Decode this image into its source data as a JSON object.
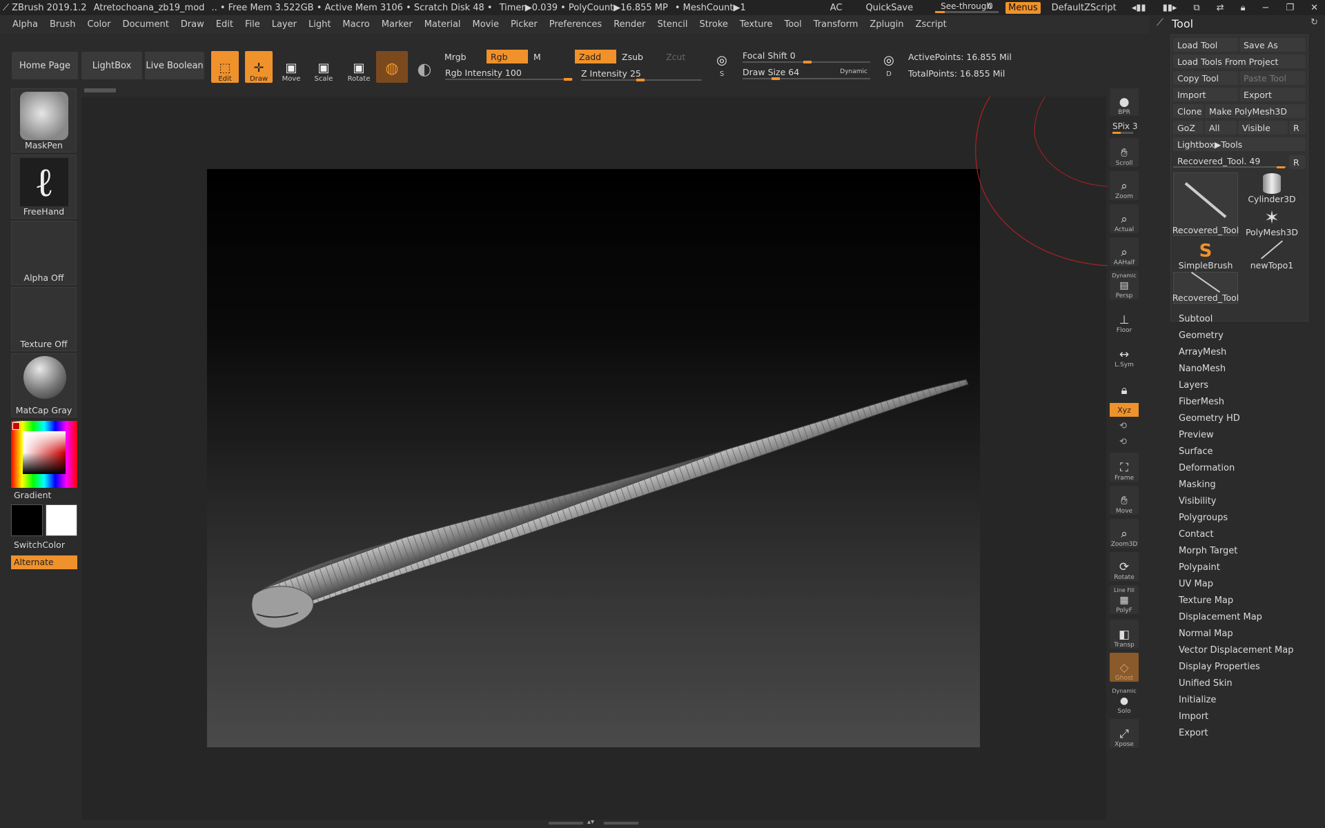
{
  "titlebar": {
    "app": "ZBrush 2019.1.2",
    "document": "Atretochoana_zb19_mod",
    "status": ".. • Free Mem 3.522GB • Active Mem 3106 • Scratch Disk 48 •",
    "timer": "Timer▶0.039 • PolyCount▶16.855 MP",
    "meshcount": "• MeshCount▶1",
    "ac": "AC",
    "quicksave": "QuickSave",
    "seethrough": "See-through",
    "seethrough_value": "0",
    "menus": "Menus",
    "script": "DefaultZScript"
  },
  "menubar": [
    "Alpha",
    "Brush",
    "Color",
    "Document",
    "Draw",
    "Edit",
    "File",
    "Layer",
    "Light",
    "Macro",
    "Marker",
    "Material",
    "Movie",
    "Picker",
    "Preferences",
    "Render",
    "Stencil",
    "Stroke",
    "Texture",
    "Tool",
    "Transform",
    "Zplugin",
    "Zscript"
  ],
  "toolbar": {
    "home": "Home Page",
    "lightbox": "LightBox",
    "liveboolean": "Live Boolean",
    "edit": "Edit",
    "draw": "Draw",
    "move": "Move",
    "scale": "Scale",
    "rotate": "Rotate",
    "mrgb": "Mrgb",
    "rgb": "Rgb",
    "m": "M",
    "zadd": "Zadd",
    "zsub": "Zsub",
    "zcut": "Zcut",
    "rgb_intensity_label": "Rgb Intensity",
    "rgb_intensity": "100",
    "z_intensity_label": "Z Intensity",
    "z_intensity": "25",
    "focal_shift_label": "Focal Shift",
    "focal_shift": "0",
    "draw_size_label": "Draw Size",
    "draw_size": "64",
    "dynamic": "Dynamic",
    "active_points": "ActivePoints: 16.855 Mil",
    "total_points": "TotalPoints: 16.855 Mil",
    "s_label": "S",
    "d_label": "D"
  },
  "left_shelf": {
    "brush": "MaskPen",
    "stroke": "FreeHand",
    "alpha": "Alpha Off",
    "texture": "Texture Off",
    "material": "MatCap Gray",
    "gradient": "Gradient",
    "switchcolor": "SwitchColor",
    "alternate": "Alternate"
  },
  "right_tools": {
    "bpr": "BPR",
    "spix": "SPix 3",
    "scroll": "Scroll",
    "zoom": "Zoom",
    "actual": "Actual",
    "aahalf": "AAHalf",
    "persp_top": "Dynamic",
    "persp": "Persp",
    "floor": "Floor",
    "lsym": "L.Sym",
    "xyz": "Xyz",
    "frame": "Frame",
    "move": "Move",
    "zoom3d": "Zoom3D",
    "rotate": "Rotate",
    "polyf_top": "Line Fill",
    "polyf": "PolyF",
    "transp": "Transp",
    "ghost": "Ghost",
    "solo_top": "Dynamic",
    "solo": "Solo",
    "xpose": "Xpose"
  },
  "palette": {
    "title": "Tool",
    "load_tool": "Load Tool",
    "save_as": "Save As",
    "load_from_project": "Load Tools From Project",
    "copy_tool": "Copy Tool",
    "paste_tool": "Paste Tool",
    "import": "Import",
    "export": "Export",
    "clone": "Clone",
    "make_polymesh": "Make PolyMesh3D",
    "goz": "GoZ",
    "all": "All",
    "visible": "Visible",
    "r": "R",
    "lightbox_tools": "Lightbox▶Tools",
    "current_tool": "Recovered_Tool.",
    "current_tool_value": "49",
    "thumbs": [
      "Recovered_Tool",
      "Cylinder3D",
      "PolyMesh3D",
      "SimpleBrush",
      "newTopo1",
      "Recovered_Tool"
    ],
    "subpalettes": [
      "Subtool",
      "Geometry",
      "ArrayMesh",
      "NanoMesh",
      "Layers",
      "FiberMesh",
      "Geometry HD",
      "Preview",
      "Surface",
      "Deformation",
      "Masking",
      "Visibility",
      "Polygroups",
      "Contact",
      "Morph Target",
      "Polypaint",
      "UV Map",
      "Texture Map",
      "Displacement Map",
      "Normal Map",
      "Vector Displacement Map",
      "Display Properties",
      "Unified Skin",
      "Initialize",
      "Import",
      "Export"
    ]
  },
  "colors": {
    "accent": "#f0922b",
    "bg": "#2b2b2b"
  }
}
